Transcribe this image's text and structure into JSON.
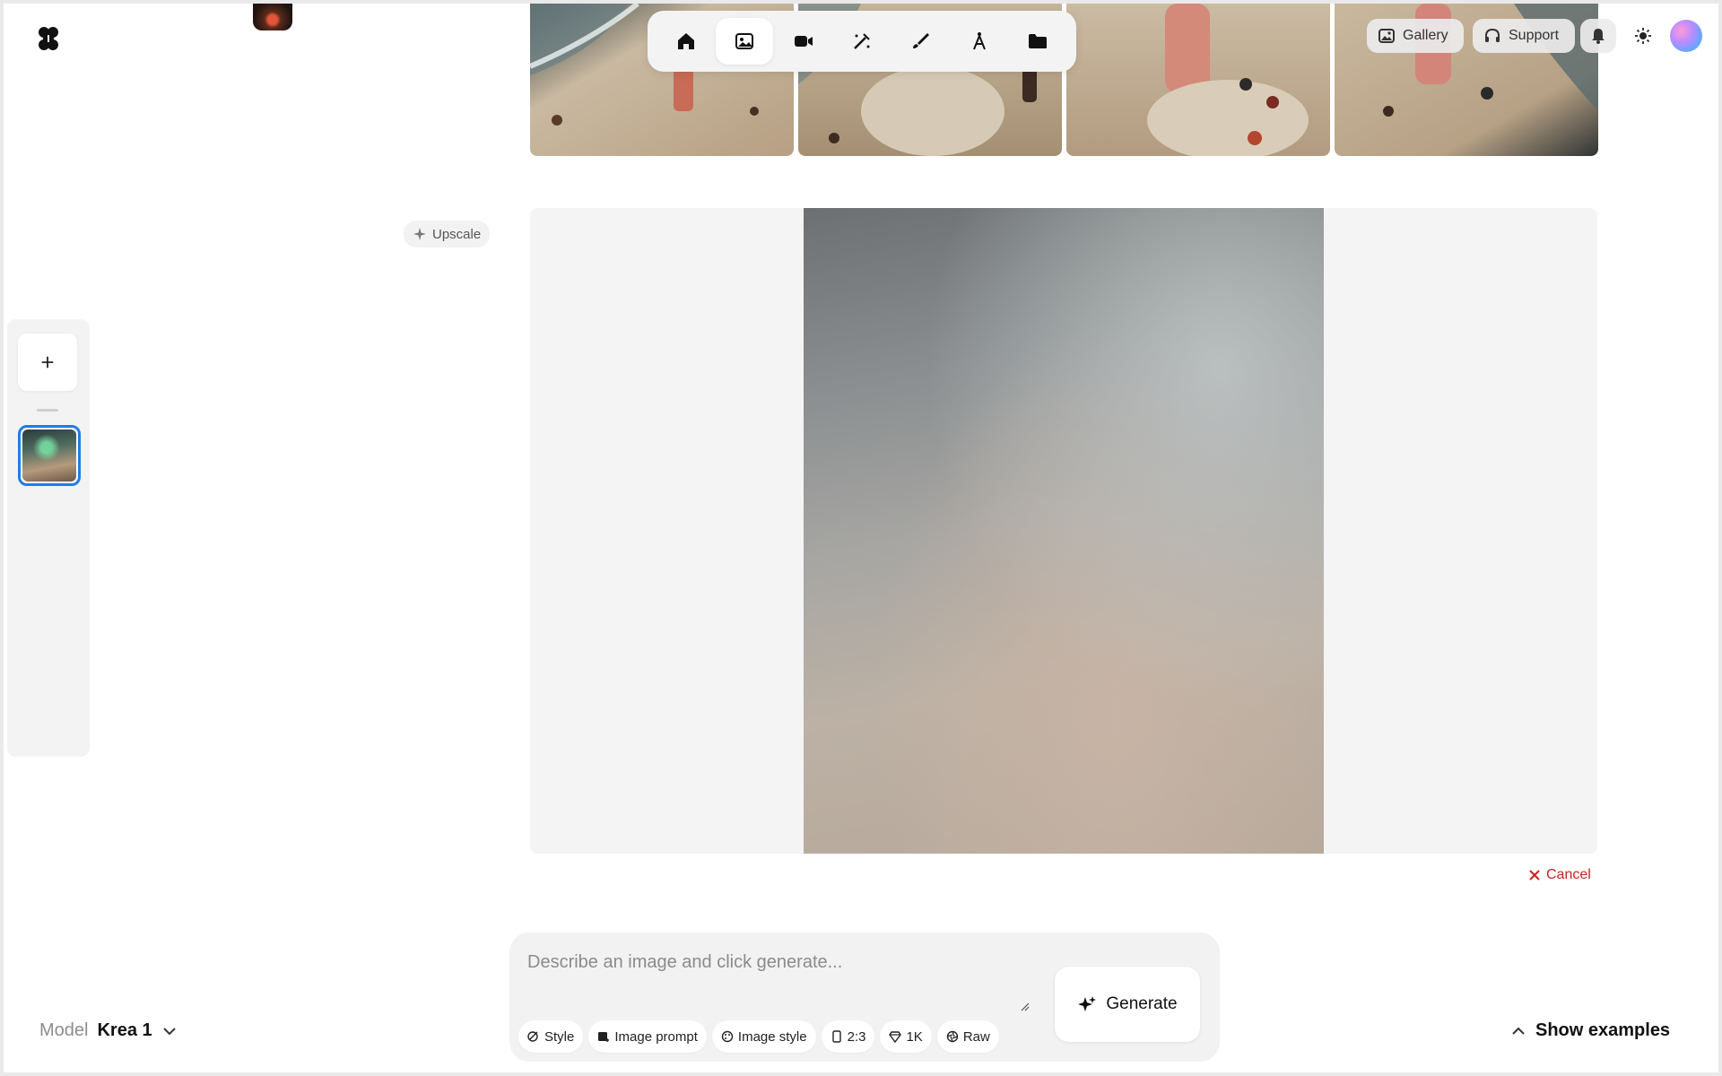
{
  "header": {
    "nav": [
      {
        "name": "home",
        "icon": "home-icon",
        "active": false
      },
      {
        "name": "image",
        "icon": "image-icon",
        "active": true
      },
      {
        "name": "video",
        "icon": "video-icon",
        "active": false
      },
      {
        "name": "enhance",
        "icon": "magic-wand-icon",
        "active": false
      },
      {
        "name": "edit",
        "icon": "brush-icon",
        "active": false
      },
      {
        "name": "train",
        "icon": "compass-icon",
        "active": false
      },
      {
        "name": "assets",
        "icon": "folder-icon",
        "active": false
      }
    ],
    "gallery_label": "Gallery",
    "support_label": "Support"
  },
  "canvas": {
    "upscale_label": "Upscale",
    "cancel_label": "Cancel"
  },
  "prompt": {
    "placeholder": "Describe an image and click generate...",
    "value": "",
    "generate_label": "Generate",
    "chips": {
      "style": "Style",
      "image_prompt": "Image prompt",
      "image_style": "Image style",
      "aspect": "2:3",
      "resolution": "1K",
      "raw": "Raw"
    }
  },
  "footer": {
    "model_label": "Model",
    "model_value": "Krea 1",
    "show_examples_label": "Show examples"
  },
  "colors": {
    "accent_blue": "#1e7ce8",
    "cancel_red": "#c22525",
    "panel_gray": "#f2f2f2"
  }
}
